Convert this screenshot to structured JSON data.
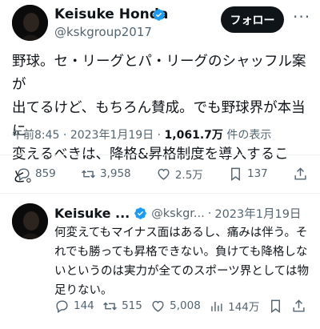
{
  "tweet": {
    "author_name": "Keisuke Honda",
    "author_handle": "@kskgroup2017",
    "follow_label": "フォロー",
    "more_label": "···",
    "text_lines": [
      "野球。セ・リーグとパ・リーグのシャッフル案が",
      "出てるけど、もちろん賛成。でも野球界が本当に",
      "変えるべきは、降格&昇格制度を導入すること。"
    ],
    "time": "午前8:45",
    "sep": "·",
    "date": "2023年1月19日",
    "views": "1,061.7万",
    "views_label": "件の表示",
    "replies": "859",
    "retweets": "3,958",
    "likes": "2.5万",
    "bookmarks": "137"
  },
  "reply": {
    "author_name": "Keisuke ...",
    "author_handle": "@kskgr...",
    "sep": "·",
    "date": "2023年1月19日",
    "text_lines": [
      "何変えてもマイナス面はあるし、痛みは伴う。そ",
      "れでも勝っても昇格できない。負けても降格しな",
      "いというのは実力が全てのスポーツ界としては物",
      "足りない。"
    ],
    "replies": "144",
    "retweets": "515",
    "likes": "5,008",
    "views": "144万"
  },
  "colors": {
    "verified": "#1d9bf0",
    "text": "#0f1419",
    "muted": "#536471"
  }
}
